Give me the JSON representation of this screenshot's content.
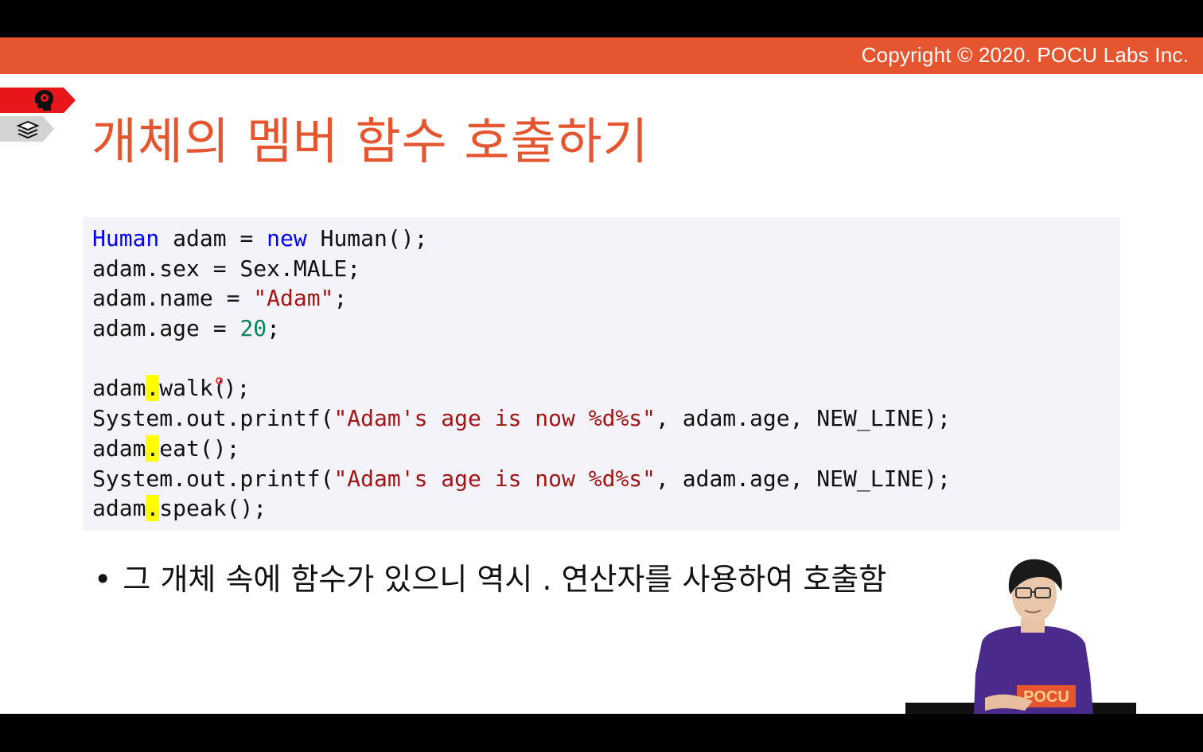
{
  "header": {
    "copyright": "Copyright © 2020. POCU Labs Inc."
  },
  "slide": {
    "title": "개체의 멤버 함수 호출하기"
  },
  "code": {
    "lines": [
      [
        {
          "t": "Human",
          "c": "kw"
        },
        {
          "t": " adam = "
        },
        {
          "t": "new",
          "c": "kw"
        },
        {
          "t": " Human();"
        }
      ],
      [
        {
          "t": "adam.sex = Sex.MALE;"
        }
      ],
      [
        {
          "t": "adam.name = "
        },
        {
          "t": "\"Adam\"",
          "c": "str"
        },
        {
          "t": ";"
        }
      ],
      [
        {
          "t": "adam.age = "
        },
        {
          "t": "20",
          "c": "num"
        },
        {
          "t": ";"
        }
      ],
      [],
      [
        {
          "t": "adam"
        },
        {
          "t": ".",
          "c": "hl"
        },
        {
          "t": "walk("
        },
        {
          "t": "",
          "c": "cursor"
        },
        {
          "t": ");"
        }
      ],
      [
        {
          "t": "System.out.printf("
        },
        {
          "t": "\"Adam's age is now %d%s\"",
          "c": "str"
        },
        {
          "t": ", adam.age, NEW_LINE);"
        }
      ],
      [
        {
          "t": "adam"
        },
        {
          "t": ".",
          "c": "hl"
        },
        {
          "t": "eat();"
        }
      ],
      [
        {
          "t": "System.out.printf("
        },
        {
          "t": "\"Adam's age is now %d%s\"",
          "c": "str"
        },
        {
          "t": ", adam.age, NEW_LINE);"
        }
      ],
      [
        {
          "t": "adam"
        },
        {
          "t": ".",
          "c": "hl"
        },
        {
          "t": "speak();"
        }
      ]
    ]
  },
  "bullets": [
    {
      "symbol": "•",
      "text": "그 개체 속에 함수가 있으니 역시 . 연산자를 사용하여 호출함"
    }
  ],
  "icons": {
    "tag_red": "brain-head-icon",
    "tag_grey": "book-stack-icon"
  },
  "presenter": {
    "shirt_text": "POCU"
  },
  "colors": {
    "accent": "#e5552f",
    "tag_red": "#e8151b",
    "keyword": "#0000ff",
    "string": "#a31515",
    "number": "#098658",
    "highlight": "#ffff00"
  }
}
